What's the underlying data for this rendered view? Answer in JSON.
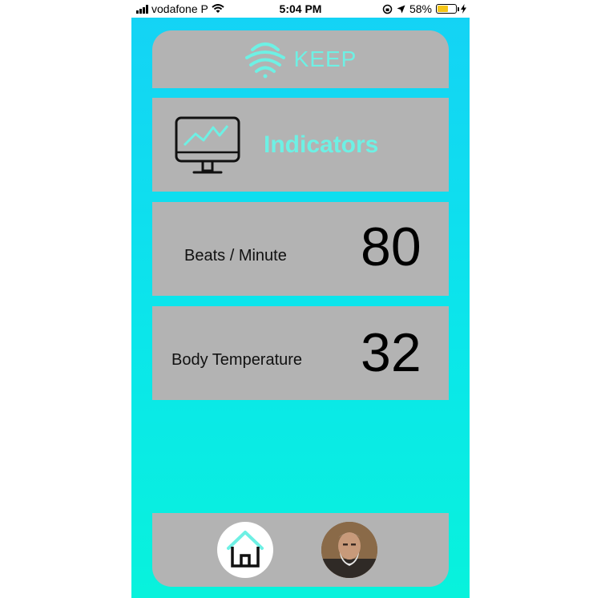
{
  "status_bar": {
    "carrier": "vodafone P",
    "time": "5:04 PM",
    "battery_percent": "58%",
    "battery_level": 0.58
  },
  "header": {
    "logo_icon": "wifi-signal-icon",
    "title": "KEEP"
  },
  "indicators": {
    "icon": "monitor-chart-icon",
    "title": "Indicators"
  },
  "metrics": [
    {
      "label": "Beats / Minute",
      "value": "80"
    },
    {
      "label": "Body Temperature",
      "value": "32"
    }
  ],
  "nav": {
    "home_icon": "home-icon",
    "profile_icon": "profile-avatar"
  },
  "colors": {
    "accent": "#6ef0e4",
    "card": "#b3b3b3",
    "gradient_top": "#14d3f5",
    "gradient_bottom": "#08f2dc"
  }
}
